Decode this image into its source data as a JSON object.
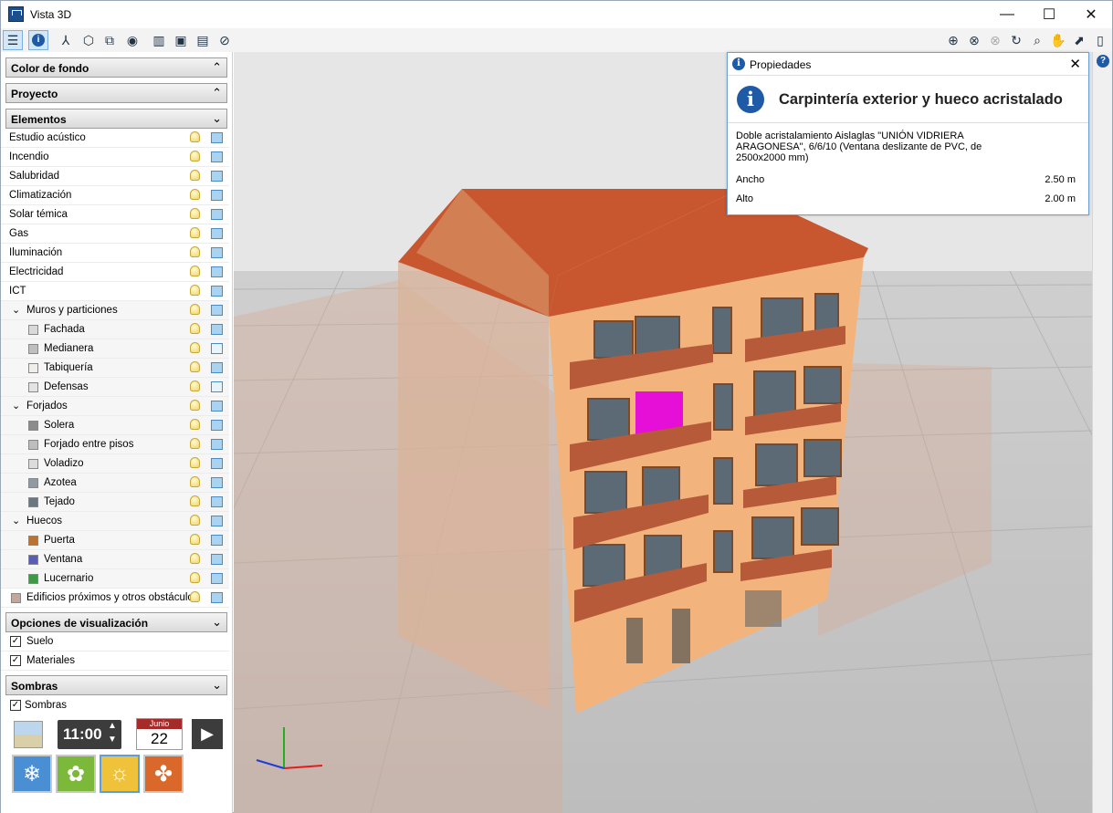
{
  "window": {
    "title": "Vista 3D",
    "minimize": "—",
    "maximize": "☐",
    "close": "✕"
  },
  "toolbar": {
    "left": [
      "layers-icon",
      "info-icon",
      "axes-icon",
      "solid-view-icon",
      "wire-view-icon",
      "visibility-icon",
      "section-icon",
      "plan-icon",
      "grid-icon",
      "hide-icon"
    ],
    "right": [
      "zoom-all-icon",
      "zoom-window-icon",
      "zoom-prev-icon",
      "rotate-icon",
      "zoom-icon",
      "pan-icon",
      "export-icon",
      "book-icon"
    ]
  },
  "panel": {
    "sections": {
      "color_fondo": "Color de fondo",
      "proyecto": "Proyecto",
      "elementos": "Elementos",
      "opciones": "Opciones de visualización",
      "sombras": "Sombras"
    },
    "elements": [
      {
        "label": "Estudio acústico"
      },
      {
        "label": "Incendio"
      },
      {
        "label": "Salubridad"
      },
      {
        "label": "Climatización"
      },
      {
        "label": "Solar témica"
      },
      {
        "label": "Gas"
      },
      {
        "label": "Iluminación"
      },
      {
        "label": "Electricidad"
      },
      {
        "label": "ICT"
      },
      {
        "label": "Muros y particiones",
        "group": true
      },
      {
        "label": "Fachada",
        "color": "#d9d9d9"
      },
      {
        "label": "Medianera",
        "color": "#bfbfbf"
      },
      {
        "label": "Tabiquería",
        "color": "#f0eeea"
      },
      {
        "label": "Defensas",
        "color": "#e3e3e3"
      },
      {
        "label": "Forjados",
        "group": true
      },
      {
        "label": "Solera",
        "color": "#8c8c8c"
      },
      {
        "label": "Forjado entre pisos",
        "color": "#bdbdbd"
      },
      {
        "label": "Voladizo",
        "color": "#dcdcdc"
      },
      {
        "label": "Azotea",
        "color": "#8f9aa3"
      },
      {
        "label": "Tejado",
        "color": "#6b7680"
      },
      {
        "label": "Huecos",
        "group": true
      },
      {
        "label": "Puerta",
        "color": "#b87333"
      },
      {
        "label": "Ventana",
        "color": "#5b5bb8"
      },
      {
        "label": "Lucernario",
        "color": "#3f9a48"
      },
      {
        "label": "Edificios próximos y otros obstáculos",
        "color": "#c4a79a"
      }
    ],
    "options": [
      {
        "label": "Suelo",
        "checked": "✓"
      },
      {
        "label": "Materiales",
        "checked": "✓"
      }
    ],
    "sombras_check": {
      "label": "Sombras",
      "checked": "✓"
    },
    "time": "11:00",
    "calendar": {
      "month": "Junio",
      "day": "22"
    },
    "seasons": [
      "winter-icon",
      "spring-icon",
      "summer-icon",
      "autumn-icon"
    ]
  },
  "properties": {
    "title": "Propiedades",
    "heading": "Carpintería exterior y hueco acristalado",
    "description": "Doble acristalamiento Aislaglas \"UNIÓN VIDRIERA ARAGONESA\", 6/6/10 (Ventana deslizante de PVC, de 2500x2000 mm)",
    "rows": [
      {
        "label": "Ancho",
        "value": "2.50 m"
      },
      {
        "label": "Alto",
        "value": "2.00 m"
      }
    ]
  },
  "colors": {
    "accent": "#1e5aa6",
    "highlight": "#e60fd8",
    "facade": "#f2b47c",
    "roof": "#c8562f"
  }
}
